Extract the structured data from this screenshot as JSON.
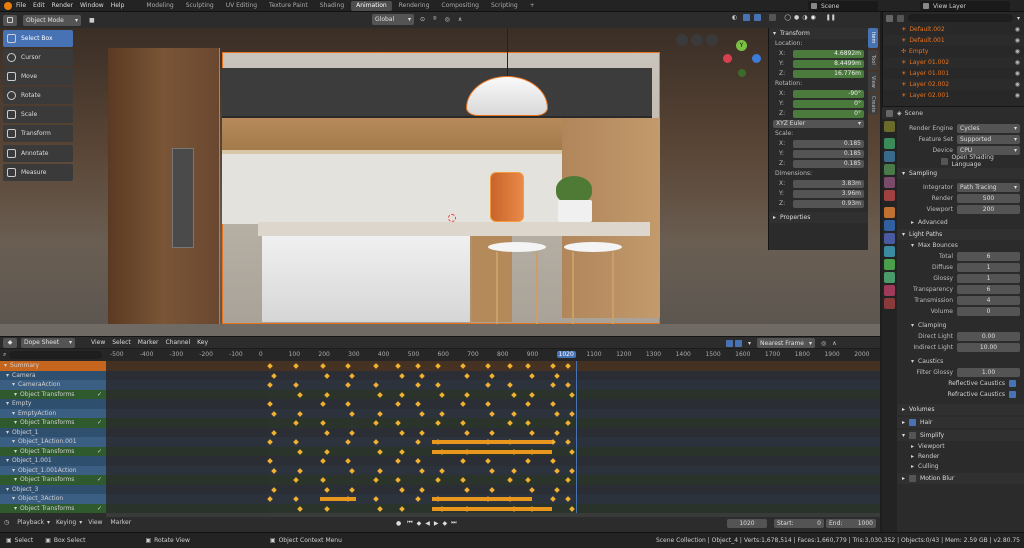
{
  "topbar": {
    "menus": [
      "File",
      "Edit",
      "Render",
      "Window",
      "Help"
    ],
    "workspaces": [
      "Modeling",
      "Sculpting",
      "UV Editing",
      "Texture Paint",
      "Shading",
      "Animation",
      "Rendering",
      "Compositing",
      "Scripting"
    ],
    "active_workspace": "Animation",
    "add_tab": "+",
    "scene_label": "Scene",
    "view_layer_label": "View Layer"
  },
  "viewport": {
    "mode": "Object Mode",
    "orientation": "Global",
    "tools": [
      "Select Box",
      "Cursor",
      "Move",
      "Rotate",
      "Scale",
      "Transform",
      "Annotate",
      "Measure"
    ],
    "active_tool": "Select Box",
    "gizmo_labels": {
      "y": "Y",
      "x": "X",
      "z": "Z"
    }
  },
  "npanel": {
    "tabs": [
      "Item",
      "Tool",
      "View",
      "Create"
    ],
    "title": "Transform",
    "location_label": "Location:",
    "location": {
      "x": "4.6892m",
      "y": "8.4499m",
      "z": "16.776m"
    },
    "rotation_label": "Rotation:",
    "rotation": {
      "x": "-90°",
      "y": "0°",
      "z": "0°"
    },
    "rotation_mode": "XYZ Euler",
    "scale_label": "Scale:",
    "scale": {
      "x": "0.185",
      "y": "0.185",
      "z": "0.185"
    },
    "dimensions_label": "Dimensions:",
    "dimensions": {
      "x": "3.83m",
      "y": "3.96m",
      "z": "0.93m"
    },
    "properties_label": "Properties"
  },
  "dopesheet": {
    "editor": "Dope Sheet",
    "menus": [
      "View",
      "Select",
      "Marker",
      "Channel",
      "Key"
    ],
    "snap": "Nearest Frame",
    "ruler": [
      "-500",
      "-400",
      "-300",
      "-200",
      "-100",
      "0",
      "100",
      "200",
      "300",
      "400",
      "500",
      "600",
      "700",
      "800",
      "900",
      "1020",
      "1100",
      "1200",
      "1300",
      "1400",
      "1500",
      "1600",
      "1700",
      "1800",
      "1900",
      "2000"
    ],
    "current_frame": "1020",
    "channels": [
      {
        "name": "Summary",
        "type": "summary"
      },
      {
        "name": "Camera",
        "type": "object"
      },
      {
        "name": "CameraAction",
        "type": "action"
      },
      {
        "name": "Object Transforms",
        "type": "group"
      },
      {
        "name": "Empty",
        "type": "object"
      },
      {
        "name": "EmptyAction",
        "type": "action"
      },
      {
        "name": "Object Transforms",
        "type": "group"
      },
      {
        "name": "Object_1",
        "type": "object"
      },
      {
        "name": "Object_1Action.001",
        "type": "action"
      },
      {
        "name": "Object Transforms",
        "type": "group"
      },
      {
        "name": "Object_1.001",
        "type": "object"
      },
      {
        "name": "Object_1.001Action",
        "type": "action"
      },
      {
        "name": "Object Transforms",
        "type": "group"
      },
      {
        "name": "Object_3",
        "type": "object"
      },
      {
        "name": "Object_3Action",
        "type": "action"
      },
      {
        "name": "Object Transforms",
        "type": "group"
      }
    ],
    "footer": {
      "playback": "Playback",
      "keying": "Keying",
      "view": "View",
      "marker": "Marker",
      "frame": "1020",
      "start_label": "Start:",
      "start": "0",
      "end_label": "End:",
      "end": "1000"
    }
  },
  "status": {
    "left": [
      "Select",
      "Box Select",
      "Rotate View",
      "Object Context Menu"
    ],
    "right": "Scene Collection | Object_4 | Verts:1,678,514 | Faces:1,660,779 | Tris:3,030,352 | Objects:0/43 | Mem: 2.59 GB | v2.80.75"
  },
  "outliner": {
    "items": [
      "Default.002",
      "Default.001",
      "Empty",
      "Layer 01.002",
      "Layer 01.001",
      "Layer 02.002",
      "Layer 02.001"
    ]
  },
  "properties": {
    "header": "Scene",
    "render_engine_label": "Render Engine",
    "render_engine": "Cycles",
    "feature_set_label": "Feature Set",
    "feature_set": "Supported",
    "device_label": "Device",
    "device": "CPU",
    "osl_label": "Open Shading Language",
    "sampling": "Sampling",
    "integrator_label": "Integrator",
    "integrator": "Path Tracing",
    "render_label": "Render",
    "render": "500",
    "viewport_label": "Viewport",
    "viewport": "200",
    "advanced": "Advanced",
    "light_paths": "Light Paths",
    "max_bounces": "Max Bounces",
    "total_label": "Total",
    "total": "6",
    "diffuse_label": "Diffuse",
    "diffuse": "1",
    "glossy_label": "Glossy",
    "glossy": "1",
    "transparency_label": "Transparency",
    "transparency": "6",
    "transmission_label": "Transmission",
    "transmission": "4",
    "volume_label": "Volume",
    "volume": "0",
    "clamping": "Clamping",
    "direct_light_label": "Direct Light",
    "direct_light": "0.00",
    "indirect_light_label": "Indirect Light",
    "indirect_light": "10.00",
    "caustics": "Caustics",
    "filter_glossy_label": "Filter Glossy",
    "filter_glossy": "1.00",
    "reflective_caustics": "Reflective Caustics",
    "refractive_caustics": "Refractive Caustics",
    "volumes": "Volumes",
    "hair": "Hair",
    "simplify": "Simplify",
    "simplify_viewport": "Viewport",
    "simplify_render": "Render",
    "culling": "Culling",
    "motion_blur": "Motion Blur"
  }
}
